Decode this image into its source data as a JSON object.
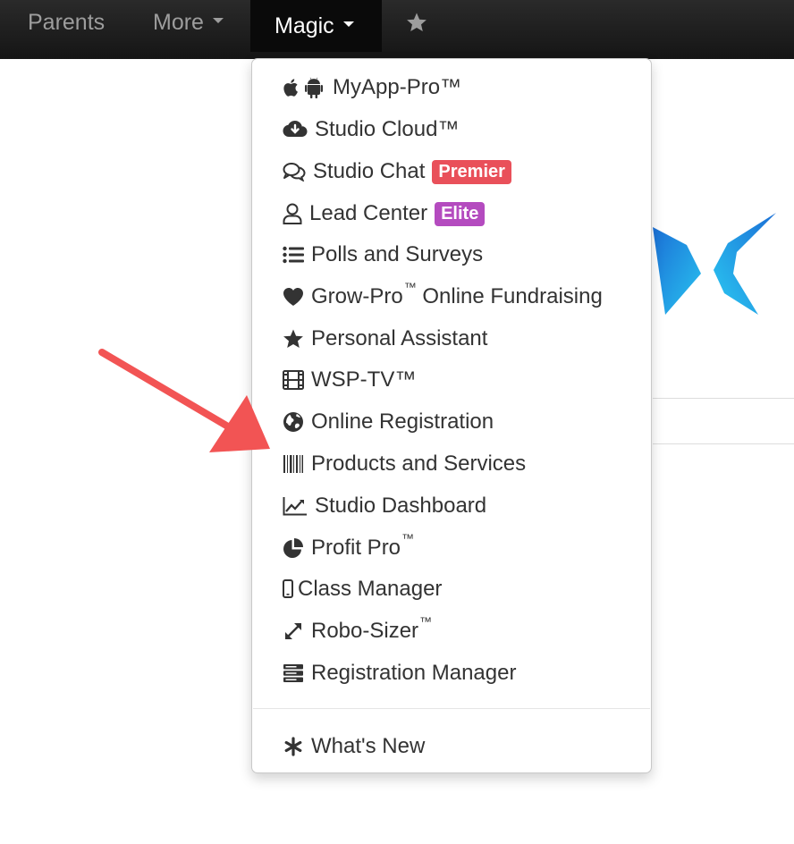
{
  "navbar": {
    "items": [
      {
        "label": "Parents"
      },
      {
        "label": "More"
      },
      {
        "label": "Magic"
      }
    ],
    "star_icon": "star-icon"
  },
  "menu": {
    "items": [
      {
        "label": "MyApp-Pro™",
        "icon": "apple-android-icon"
      },
      {
        "label": "Studio Cloud™",
        "icon": "cloud-download-icon"
      },
      {
        "label": "Studio Chat",
        "icon": "chat-bubbles-icon",
        "badge": "Premier",
        "badge_color": "#e9505a"
      },
      {
        "label": "Lead Center",
        "icon": "user-icon",
        "badge": "Elite",
        "badge_color": "#b44bbf"
      },
      {
        "label": "Polls and Surveys",
        "icon": "list-icon"
      },
      {
        "label": "Grow-Pro",
        "suffix": " Online Fundraising",
        "icon": "heart-icon",
        "tm": "™"
      },
      {
        "label": "Personal Assistant",
        "icon": "star-icon"
      },
      {
        "label": "WSP-TV™",
        "icon": "film-icon"
      },
      {
        "label": "Online Registration",
        "icon": "globe-icon"
      },
      {
        "label": "Products and Services",
        "icon": "barcode-icon"
      },
      {
        "label": "Studio Dashboard",
        "icon": "line-chart-icon"
      },
      {
        "label": "Profit Pro",
        "icon": "pie-chart-icon",
        "tm": "™"
      },
      {
        "label": "Class Manager",
        "icon": "mobile-icon"
      },
      {
        "label": "Robo-Sizer",
        "icon": "resize-icon",
        "tm": "™"
      },
      {
        "label": "Registration Manager",
        "icon": "server-icon"
      }
    ],
    "footer_item": {
      "label": "What's New",
      "icon": "asterisk-icon"
    }
  },
  "colors": {
    "navbar_bg": "#1b1b1b",
    "premier_badge": "#e9505a",
    "elite_badge": "#b44bbf",
    "arrow": "#f25454",
    "logo_blue": "#1aa3e8"
  }
}
